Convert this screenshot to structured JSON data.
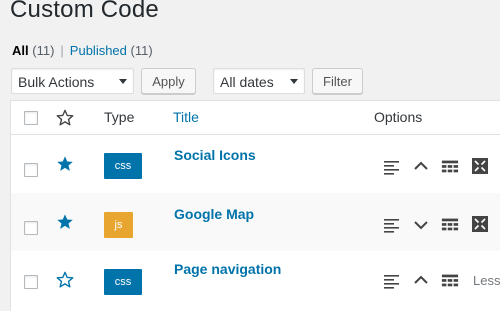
{
  "page": {
    "title": "Custom Code"
  },
  "filters": {
    "all_label": "All",
    "all_count": "(11)",
    "separator": "|",
    "published_label": "Published",
    "published_count": "(11)"
  },
  "toolbar": {
    "bulk_actions": "Bulk Actions",
    "apply_label": "Apply",
    "dates": "All dates",
    "filter_label": "Filter"
  },
  "table": {
    "columns": {
      "type": "Type",
      "title": "Title",
      "options": "Options"
    },
    "rows": [
      {
        "type": "css",
        "title": "Social Icons",
        "starred": true,
        "toggle": "collapse"
      },
      {
        "type": "js",
        "title": "Google Map",
        "starred": true,
        "toggle": "expand"
      },
      {
        "type": "css",
        "title": "Page navigation",
        "starred": false,
        "toggle": "collapse",
        "extra": "Less"
      }
    ]
  },
  "colors": {
    "accent": "#0073aa",
    "css_badge": "#0073aa",
    "js_badge": "#e8a631"
  }
}
